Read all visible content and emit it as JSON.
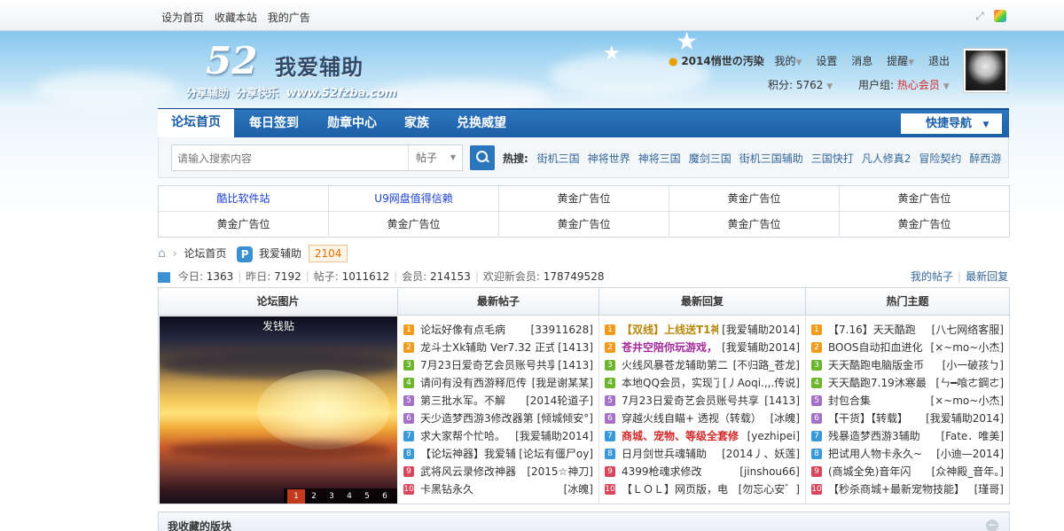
{
  "topbar": {
    "links": [
      "设为首页",
      "收藏本站",
      "我的广告"
    ],
    "icons": [
      "expand-icon",
      "colorful-app-icon"
    ]
  },
  "logo": {
    "num": "52",
    "name": "我爱辅助",
    "slogan1": "分享辅助",
    "slogan2": "分享快乐",
    "url": "www.52fzba.com"
  },
  "user": {
    "name": "2014悄世の汚染",
    "menu": [
      "我的",
      "设置",
      "消息",
      "提醒",
      "退出"
    ],
    "points_label": "积分:",
    "points": "5762",
    "group_label": "用户组:",
    "group": "热心会员"
  },
  "nav": {
    "tabs": [
      "论坛首页",
      "每日签到",
      "勋章中心",
      "家族",
      "兑换威望"
    ],
    "quick": "快捷导航"
  },
  "search": {
    "placeholder": "请输入搜索内容",
    "type": "帖子",
    "hot_label": "热搜:",
    "hot": [
      "街机三国",
      "神将世界",
      "神将三国",
      "魔剑三国",
      "街机三国辅助",
      "三国快打",
      "凡人修真2",
      "冒险契约",
      "醉西游"
    ]
  },
  "ads": [
    "酷比软件站",
    "U9网盘值得信赖",
    "黄金广告位",
    "黄金广告位",
    "黄金广告位",
    "黄金广告位",
    "黄金广告位",
    "黄金广告位",
    "黄金广告位",
    "黄金广告位"
  ],
  "crumb": {
    "home": "论坛首页",
    "forum": "我爱辅助",
    "count": "2104"
  },
  "stats": {
    "today_l": "今日:",
    "today": "1363",
    "yest_l": "昨日:",
    "yest": "7192",
    "posts_l": "帖子:",
    "posts": "1011612",
    "members_l": "会员:",
    "members": "214153",
    "new_l": "欢迎新会员:",
    "new": "178749528",
    "my": "我的帖子",
    "latest": "最新回复"
  },
  "board": {
    "headers": [
      "论坛图片",
      "最新帖子",
      "最新回复",
      "热门主题"
    ],
    "pic_caption": "发钱贴",
    "pages": [
      "1",
      "2",
      "3",
      "4",
      "5",
      "6"
    ],
    "num_colors": [
      "#f29a1b",
      "#f29a1b",
      "#6cb52d",
      "#6cb52d",
      "#a470c8",
      "#a470c8",
      "#3a9ad9",
      "#3a9ad9",
      "#d9455a",
      "#d9455a"
    ],
    "new_posts": [
      {
        "t": "论坛好像有点毛病",
        "a": "[33911628]"
      },
      {
        "t": "龙斗士Xk辅助 Ver7.32 正式",
        "a": "[1413]"
      },
      {
        "t": "7月23日爱奇艺会员账号共享",
        "a": "[1413]"
      },
      {
        "t": "请问有没有西游释厄传",
        "a": "[我是谢某某]"
      },
      {
        "t": "第三批水军。不解",
        "a": "[2014轮道子]"
      },
      {
        "t": "天少造梦西游3修改器第",
        "a": "[倾城倾安°]"
      },
      {
        "t": "求大家帮个忙哈。",
        "a": "[我爱辅助2014]"
      },
      {
        "t": "【论坛神器】我爱辅",
        "a": "[论坛有僵尸oy]"
      },
      {
        "t": "武将风云录修改神器",
        "a": "[2015☆神刀]"
      },
      {
        "t": "卡黑钻永久",
        "a": "[冰魄]"
      }
    ],
    "new_replies": [
      {
        "t": "【双线】上线送T1神",
        "a": "[我爱辅助2014]",
        "c": "#b5880a"
      },
      {
        "t": "苍井空陪你玩游戏，",
        "a": "[我爱辅助2014]",
        "c": "#a32a9a"
      },
      {
        "t": "火线风暴苍龙辅助第二",
        "a": "[不归路_苍龙]",
        "c": ""
      },
      {
        "t": "本地QQ会员，实现了",
        "a": "[丿Aoqi.,,.传说]",
        "c": ""
      },
      {
        "t": "7月23日爱奇艺会员账号共享",
        "a": "[1413]",
        "c": ""
      },
      {
        "t": "穿越火线自瞄+ 透视（转载）",
        "a": "[冰魄]",
        "c": ""
      },
      {
        "t": "商城、宠物、等级全套修",
        "a": "[yezhipei]",
        "c": "#d12a2a"
      },
      {
        "t": "日月剑世兵魂辅助",
        "a": "[2014丿、妖莲]",
        "c": ""
      },
      {
        "t": "4399枪魂求修改",
        "a": "[jinshou66]",
        "c": ""
      },
      {
        "t": "【ＬＯＬ】网页版，电",
        "a": "[勿忘心安゛]",
        "c": ""
      }
    ],
    "hot": [
      {
        "t": "【7.16】天天酷跑",
        "a": "[八七网络客服]"
      },
      {
        "t": "BOOS自动扣血进化",
        "a": "[×~mo~小杰]"
      },
      {
        "t": "天天酷跑电脑版金币",
        "a": "[小一破孩ㄅ]"
      },
      {
        "t": "天天酷跑7.19沐寒最",
        "a": "[ㄣ━喰ㄜ鋼ㄜ]"
      },
      {
        "t": "封包合集",
        "a": "[×~mo~小杰]"
      },
      {
        "t": "【干货】【转载】",
        "a": "[我爱辅助2014]"
      },
      {
        "t": "残暴造梦西游3辅助",
        "a": "[Fate．唯美]"
      },
      {
        "t": "把试用人物卡永久~",
        "a": "[小迪—2014]"
      },
      {
        "t": "(商城全免)音年闪",
        "a": "[众神殿_音年。]"
      },
      {
        "t": "【秒杀商城+最新宠物技能】",
        "a": "[瑾哥]"
      }
    ]
  },
  "fav": {
    "title": "我收藏的版块",
    "collapse": "−"
  }
}
